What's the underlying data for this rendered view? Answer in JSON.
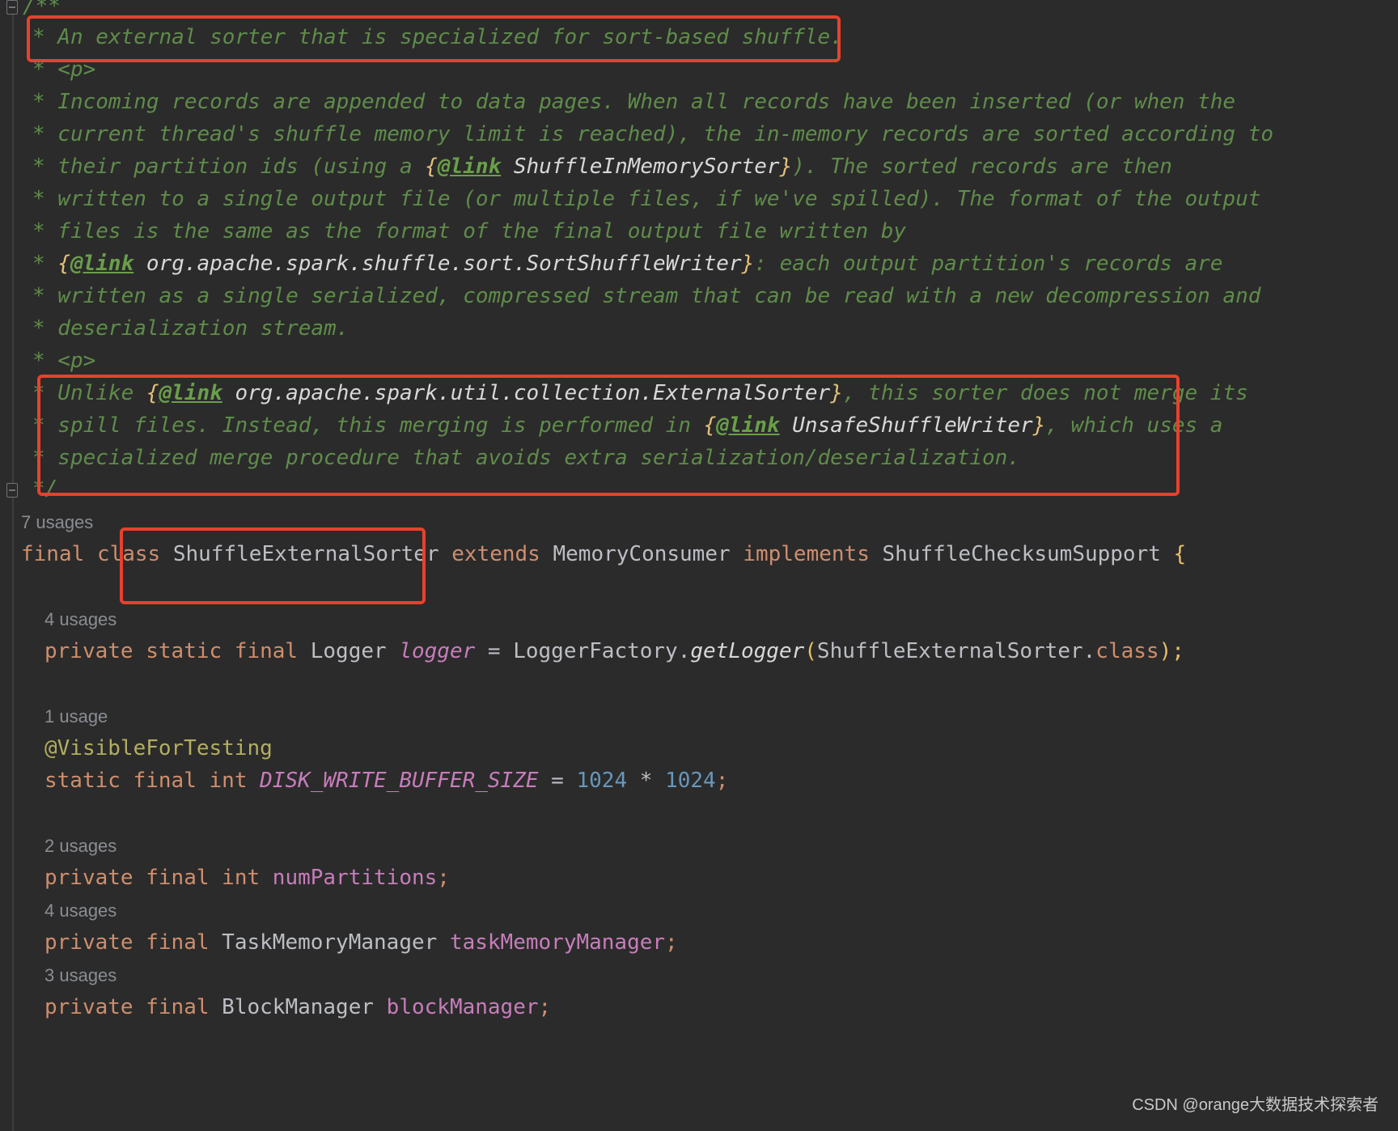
{
  "doc_comment": {
    "open": "/**",
    "lines": [
      "* An external sorter that is specialized for sort-based shuffle.",
      "* <p>",
      "* Incoming records are appended to data pages. When all records have been inserted (or when the",
      "* current thread's shuffle memory limit is reached), the in-memory records are sorted according to",
      "* their partition ids (using a ",
      "ShuffleInMemorySorter",
      "). The sorted records are then",
      "* written to a single output file (or multiple files, if we've spilled). The format of the output",
      "* files is the same as the format of the final output file written by",
      "* ",
      "org.apache.spark.shuffle.sort.SortShuffleWriter",
      ": each output partition's records are",
      "* written as a single serialized, compressed stream that can be read with a new decompression and",
      "* deserialization stream.",
      "* <p>",
      "* Unlike ",
      "org.apache.spark.util.collection.ExternalSorter",
      ", this sorter does not merge its",
      "* spill files. Instead, this merging is performed in ",
      "UnsafeShuffleWriter",
      ", which uses a",
      "* specialized merge procedure that avoids extra serialization/deserialization.",
      "*/"
    ],
    "link_open": "{",
    "link_tag": "@link",
    "link_close": "}"
  },
  "usages": {
    "class": "7 usages",
    "logger": "4 usages",
    "buffer": "1 usage",
    "partitions": "2 usages",
    "task_mm": "4 usages",
    "block_mm": "3 usages"
  },
  "code": {
    "kw_final": "final",
    "kw_class": "class",
    "class_name": "ShuffleExternalSorter",
    "kw_extends": "extends",
    "super_class": "MemoryConsumer",
    "kw_implements": "implements",
    "interface": "ShuffleChecksumSupport",
    "open_brace": "{",
    "kw_private": "private",
    "kw_static": "static",
    "type_logger": "Logger",
    "field_logger": "logger",
    "eq": " = ",
    "logger_factory": "LoggerFactory.",
    "get_logger": "getLogger",
    "paren_open": "(",
    "logger_arg": "ShuffleExternalSorter.",
    "kw_class_lit": "class",
    "paren_close_semi": ");",
    "annotation": "@VisibleForTesting",
    "kw_int": "int",
    "field_buffer": "DISK_WRITE_BUFFER_SIZE",
    "num_a": "1024",
    "times": " * ",
    "num_b": "1024",
    "semi": ";",
    "field_partitions": "numPartitions",
    "type_task_mm": "TaskMemoryManager",
    "field_task_mm": "taskMemoryManager",
    "type_block_mm": "BlockManager",
    "field_block_mm": "blockManager"
  },
  "colors": {
    "background": "#2b2b2b",
    "doc_comment": "#5f8c4a",
    "keyword": "#cf8e6d",
    "field": "#c77dbb",
    "number": "#6897bb",
    "annotation": "#b3ae60",
    "highlight_box": "#e8412d"
  },
  "watermark": "CSDN @orange大数据技术探索者"
}
